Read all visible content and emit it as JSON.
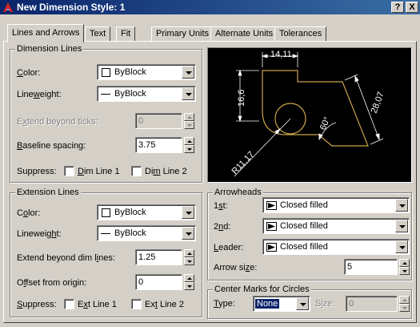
{
  "window": {
    "title": "New Dimension Style: 1",
    "help_button": "?",
    "close_button": "X"
  },
  "tabs": [
    {
      "label": "Lines and Arrows",
      "active": true
    },
    {
      "label": "Text",
      "active": false
    },
    {
      "label": "Fit",
      "active": false
    },
    {
      "label": "Primary Units",
      "active": false
    },
    {
      "label": "Alternate Units",
      "active": false
    },
    {
      "label": "Tolerances",
      "active": false
    }
  ],
  "dimension_lines": {
    "title": "Dimension Lines",
    "color_label_pre": "",
    "color_label_ul": "C",
    "color_label_post": "olor:",
    "color_value": "ByBlock",
    "lineweight_label_pre": "Line",
    "lineweight_label_ul": "w",
    "lineweight_label_post": "eight:",
    "lineweight_value": "ByBlock",
    "extend_label_pre": "E",
    "extend_label_ul": "x",
    "extend_label_post": "tend beyond ticks:",
    "extend_value": "0",
    "baseline_label_pre": "",
    "baseline_label_ul": "B",
    "baseline_label_post": "aseline spacing:",
    "baseline_value": "3.75",
    "suppress_label": "Suppress:",
    "dim_line_1_pre": "",
    "dim_line_1_ul": "D",
    "dim_line_1_post": "im Line 1",
    "dim_line_2_pre": "Di",
    "dim_line_2_ul": "m",
    "dim_line_2_post": " Line 2"
  },
  "extension_lines": {
    "title": "Extension Lines",
    "color_label_pre": "C",
    "color_label_ul": "o",
    "color_label_post": "lor:",
    "color_value": "ByBlock",
    "lineweight_label_pre": "Lineweig",
    "lineweight_label_ul": "h",
    "lineweight_label_post": "t:",
    "lineweight_value": "ByBlock",
    "extend_label_pre": "Extend beyond dim l",
    "extend_label_ul": "i",
    "extend_label_post": "nes:",
    "extend_value": "1.25",
    "offset_label_pre": "O",
    "offset_label_ul": "f",
    "offset_label_post": "fset from origin:",
    "offset_value": "0",
    "suppress_label_pre": "",
    "suppress_label_ul": "S",
    "suppress_label_post": "uppress:",
    "ext_line_1_pre": "E",
    "ext_line_1_ul": "x",
    "ext_line_1_post": "t Line 1",
    "ext_line_2_pre": "Ex",
    "ext_line_2_ul": "t",
    "ext_line_2_post": " Line 2"
  },
  "preview": {
    "dim_top": "14,11",
    "dim_left": "16,6",
    "dim_right": "28,07",
    "dim_angle": "60°",
    "dim_radius": "R11,17",
    "line_color": "#c8a24a",
    "dim_color": "#ffffff",
    "background": "#000000"
  },
  "arrowheads": {
    "title": "Arrowheads",
    "first_label_pre": "1",
    "first_label_ul": "s",
    "first_label_post": "t:",
    "first_value": "Closed filled",
    "second_label_pre": "2",
    "second_label_ul": "n",
    "second_label_post": "d:",
    "second_value": "Closed filled",
    "leader_label_pre": "",
    "leader_label_ul": "L",
    "leader_label_post": "eader:",
    "leader_value": "Closed filled",
    "size_label_pre": "Arrow si",
    "size_label_ul": "z",
    "size_label_post": "e:",
    "size_value": "5"
  },
  "center_marks": {
    "title": "Center Marks for Circles",
    "type_label_pre": "",
    "type_label_ul": "T",
    "type_label_post": "ype:",
    "type_value": "None",
    "size_label_pre": "S",
    "size_label_ul": "i",
    "size_label_post": "ze:",
    "size_value": "0"
  }
}
